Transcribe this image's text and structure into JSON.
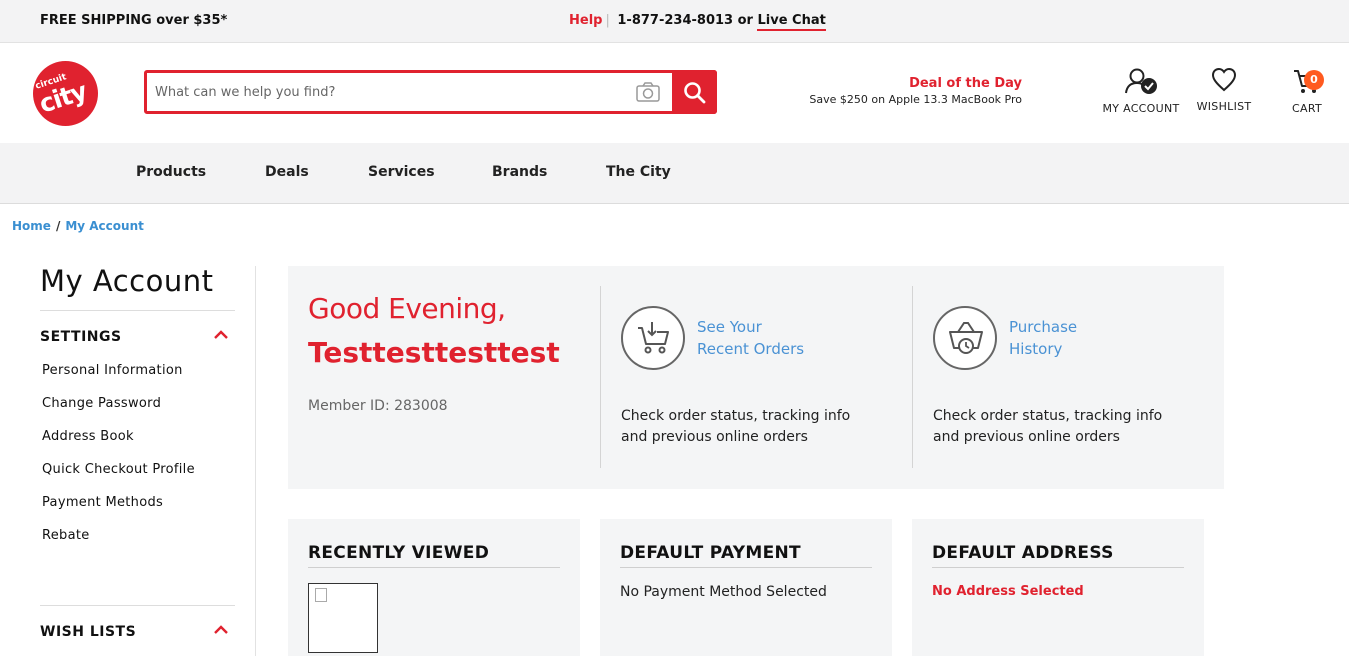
{
  "topbar": {
    "shipping": "FREE SHIPPING over $35*",
    "help": "Help",
    "separator": "|",
    "phone_prefix": "1-877-234-8013 or",
    "chat": "Live Chat"
  },
  "logo": {
    "small": "circuit",
    "big": "city"
  },
  "search": {
    "placeholder": "What can we help you find?"
  },
  "deal": {
    "title": "Deal of the Day",
    "subtitle": "Save $250 on Apple 13.3 MacBook Pro"
  },
  "header_icons": {
    "account": "MY ACCOUNT",
    "wishlist": "WISHLIST",
    "cart": "CART",
    "cart_count": "0"
  },
  "nav": {
    "items": [
      "Products",
      "Deals",
      "Services",
      "Brands",
      "The City"
    ]
  },
  "breadcrumb": {
    "home": "Home",
    "sep": "/",
    "current": "My Account"
  },
  "sidebar": {
    "title": "My Account",
    "settings_label": "SETTINGS",
    "links": [
      "Personal Information",
      "Change Password",
      "Address Book",
      "Quick Checkout Profile",
      "Payment Methods",
      "Rebate"
    ],
    "wishlists_label": "WISH LISTS"
  },
  "welcome": {
    "greeting": "Good Evening,",
    "name": "Testtesttesttest",
    "member_id": "Member ID: 283008"
  },
  "quick": [
    {
      "line1": "See Your",
      "line2": "Recent Orders",
      "desc1": "Check order status, tracking info",
      "desc2": "and previous online orders",
      "icon": "cart-icon"
    },
    {
      "line1": "Purchase",
      "line2": "History",
      "desc1": "Check order status, tracking info",
      "desc2": "and previous online orders",
      "icon": "basket-clock-icon"
    }
  ],
  "cards": {
    "recent": {
      "heading": "RECENTLY VIEWED"
    },
    "payment": {
      "heading": "DEFAULT PAYMENT",
      "value": "No Payment Method Selected"
    },
    "address": {
      "heading": "DEFAULT ADDRESS",
      "value": "No Address Selected"
    }
  },
  "colors": {
    "brand_red": "#e0222f",
    "link_blue": "#4a92d4",
    "badge_orange": "#ff5a1f",
    "panel_bg": "#f4f5f6"
  }
}
